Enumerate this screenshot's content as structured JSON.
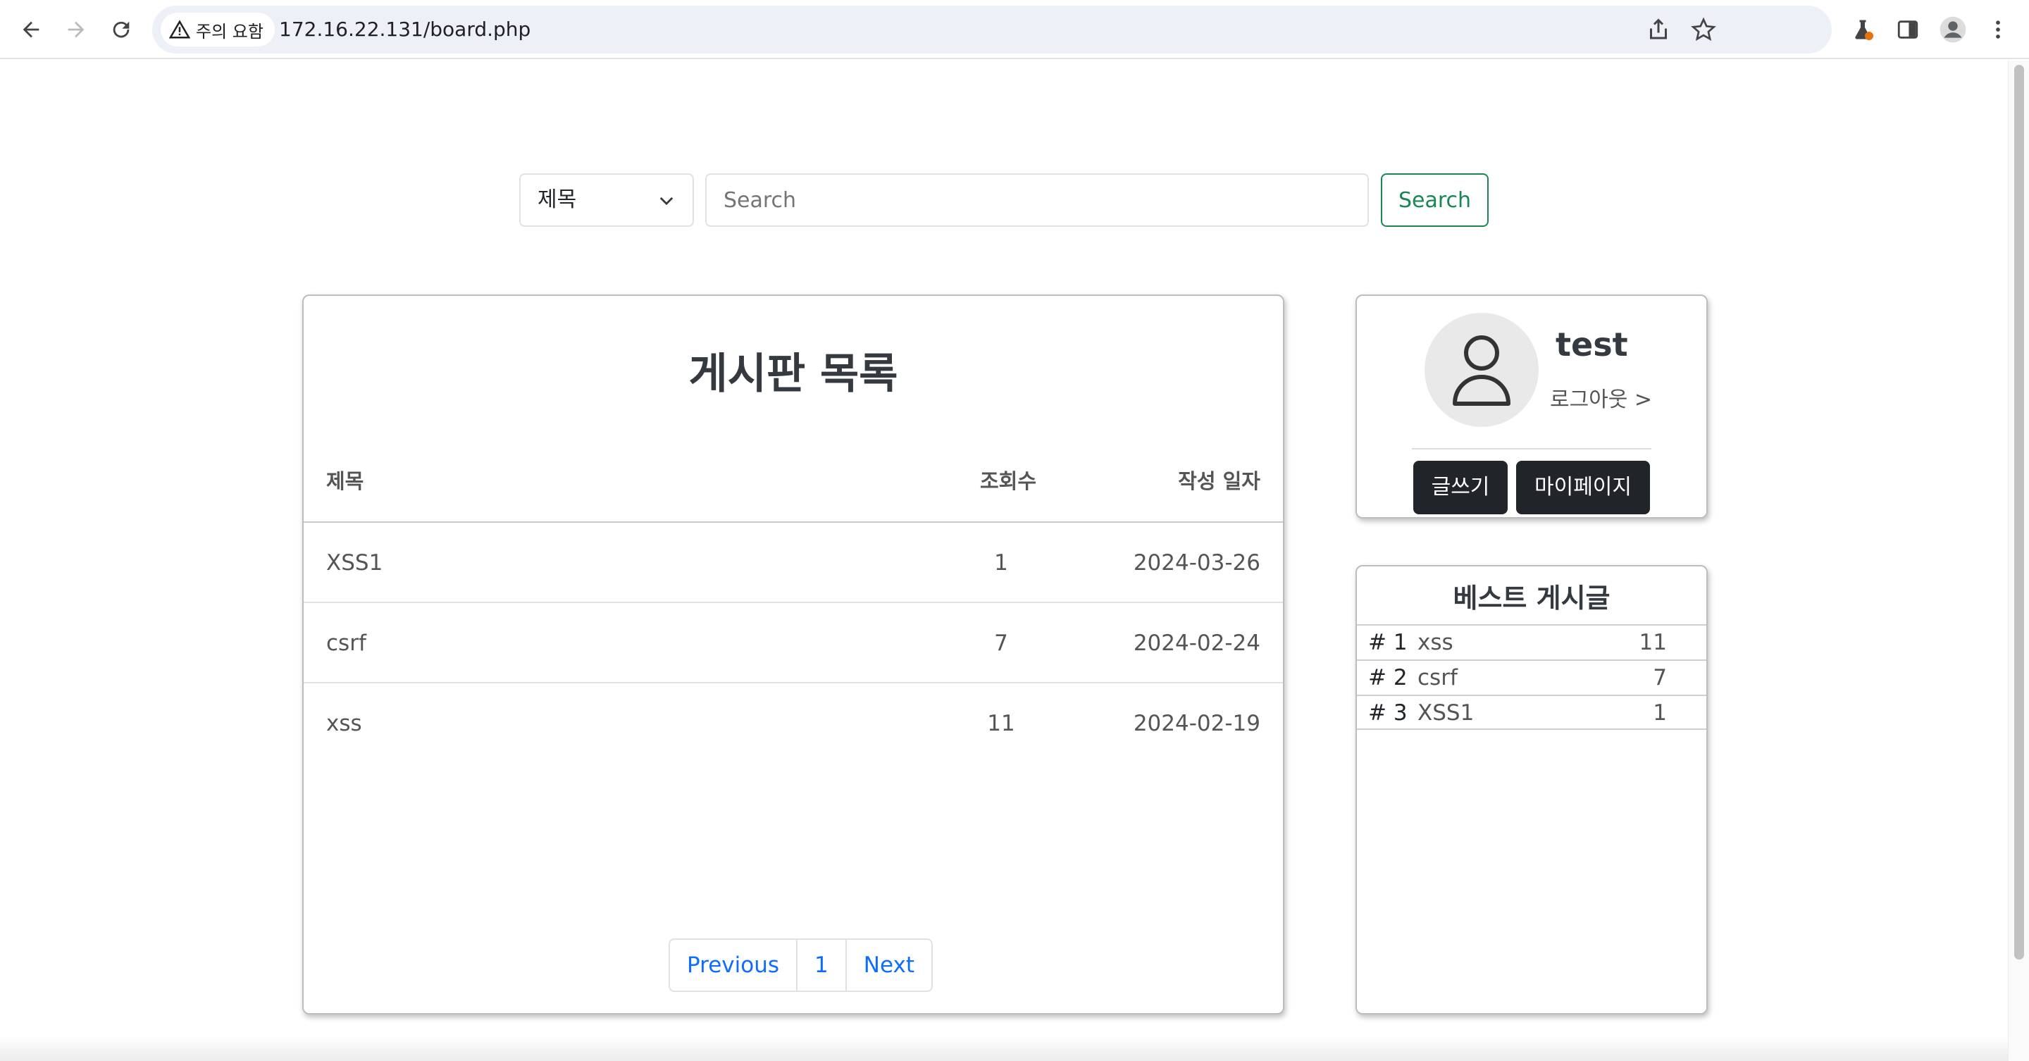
{
  "browser": {
    "security_label": "주의 요함",
    "url": "172.16.22.131/board.php"
  },
  "search": {
    "select_value": "제목",
    "placeholder": "Search",
    "button_label": "Search"
  },
  "board": {
    "title": "게시판 목록",
    "columns": {
      "title": "제목",
      "views": "조회수",
      "date": "작성 일자"
    },
    "rows": [
      {
        "title": "XSS1",
        "views": "1",
        "date": "2024-03-26"
      },
      {
        "title": "csrf",
        "views": "7",
        "date": "2024-02-24"
      },
      {
        "title": "xss",
        "views": "11",
        "date": "2024-02-19"
      }
    ],
    "pagination": {
      "previous": "Previous",
      "page": "1",
      "next": "Next"
    }
  },
  "profile": {
    "username": "test",
    "logout_label": "로그아웃 >",
    "write_label": "글쓰기",
    "mypage_label": "마이페이지"
  },
  "best": {
    "title": "베스트 게시글",
    "items": [
      {
        "rank": "# 1",
        "title": "xss",
        "views": "11"
      },
      {
        "rank": "# 2",
        "title": "csrf",
        "views": "7"
      },
      {
        "rank": "# 3",
        "title": "XSS1",
        "views": "1"
      }
    ]
  },
  "colors": {
    "primary_link": "#0d6efd",
    "success": "#198754",
    "dark": "#212529"
  }
}
